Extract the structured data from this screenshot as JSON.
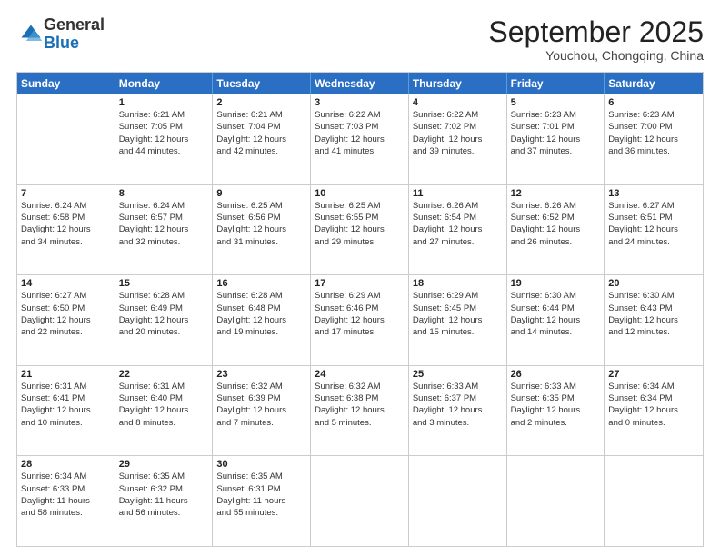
{
  "header": {
    "logo_general": "General",
    "logo_blue": "Blue",
    "month_title": "September 2025",
    "location": "Youchou, Chongqing, China"
  },
  "days_of_week": [
    "Sunday",
    "Monday",
    "Tuesday",
    "Wednesday",
    "Thursday",
    "Friday",
    "Saturday"
  ],
  "weeks": [
    [
      {
        "day": "",
        "lines": []
      },
      {
        "day": "1",
        "lines": [
          "Sunrise: 6:21 AM",
          "Sunset: 7:05 PM",
          "Daylight: 12 hours",
          "and 44 minutes."
        ]
      },
      {
        "day": "2",
        "lines": [
          "Sunrise: 6:21 AM",
          "Sunset: 7:04 PM",
          "Daylight: 12 hours",
          "and 42 minutes."
        ]
      },
      {
        "day": "3",
        "lines": [
          "Sunrise: 6:22 AM",
          "Sunset: 7:03 PM",
          "Daylight: 12 hours",
          "and 41 minutes."
        ]
      },
      {
        "day": "4",
        "lines": [
          "Sunrise: 6:22 AM",
          "Sunset: 7:02 PM",
          "Daylight: 12 hours",
          "and 39 minutes."
        ]
      },
      {
        "day": "5",
        "lines": [
          "Sunrise: 6:23 AM",
          "Sunset: 7:01 PM",
          "Daylight: 12 hours",
          "and 37 minutes."
        ]
      },
      {
        "day": "6",
        "lines": [
          "Sunrise: 6:23 AM",
          "Sunset: 7:00 PM",
          "Daylight: 12 hours",
          "and 36 minutes."
        ]
      }
    ],
    [
      {
        "day": "7",
        "lines": [
          "Sunrise: 6:24 AM",
          "Sunset: 6:58 PM",
          "Daylight: 12 hours",
          "and 34 minutes."
        ]
      },
      {
        "day": "8",
        "lines": [
          "Sunrise: 6:24 AM",
          "Sunset: 6:57 PM",
          "Daylight: 12 hours",
          "and 32 minutes."
        ]
      },
      {
        "day": "9",
        "lines": [
          "Sunrise: 6:25 AM",
          "Sunset: 6:56 PM",
          "Daylight: 12 hours",
          "and 31 minutes."
        ]
      },
      {
        "day": "10",
        "lines": [
          "Sunrise: 6:25 AM",
          "Sunset: 6:55 PM",
          "Daylight: 12 hours",
          "and 29 minutes."
        ]
      },
      {
        "day": "11",
        "lines": [
          "Sunrise: 6:26 AM",
          "Sunset: 6:54 PM",
          "Daylight: 12 hours",
          "and 27 minutes."
        ]
      },
      {
        "day": "12",
        "lines": [
          "Sunrise: 6:26 AM",
          "Sunset: 6:52 PM",
          "Daylight: 12 hours",
          "and 26 minutes."
        ]
      },
      {
        "day": "13",
        "lines": [
          "Sunrise: 6:27 AM",
          "Sunset: 6:51 PM",
          "Daylight: 12 hours",
          "and 24 minutes."
        ]
      }
    ],
    [
      {
        "day": "14",
        "lines": [
          "Sunrise: 6:27 AM",
          "Sunset: 6:50 PM",
          "Daylight: 12 hours",
          "and 22 minutes."
        ]
      },
      {
        "day": "15",
        "lines": [
          "Sunrise: 6:28 AM",
          "Sunset: 6:49 PM",
          "Daylight: 12 hours",
          "and 20 minutes."
        ]
      },
      {
        "day": "16",
        "lines": [
          "Sunrise: 6:28 AM",
          "Sunset: 6:48 PM",
          "Daylight: 12 hours",
          "and 19 minutes."
        ]
      },
      {
        "day": "17",
        "lines": [
          "Sunrise: 6:29 AM",
          "Sunset: 6:46 PM",
          "Daylight: 12 hours",
          "and 17 minutes."
        ]
      },
      {
        "day": "18",
        "lines": [
          "Sunrise: 6:29 AM",
          "Sunset: 6:45 PM",
          "Daylight: 12 hours",
          "and 15 minutes."
        ]
      },
      {
        "day": "19",
        "lines": [
          "Sunrise: 6:30 AM",
          "Sunset: 6:44 PM",
          "Daylight: 12 hours",
          "and 14 minutes."
        ]
      },
      {
        "day": "20",
        "lines": [
          "Sunrise: 6:30 AM",
          "Sunset: 6:43 PM",
          "Daylight: 12 hours",
          "and 12 minutes."
        ]
      }
    ],
    [
      {
        "day": "21",
        "lines": [
          "Sunrise: 6:31 AM",
          "Sunset: 6:41 PM",
          "Daylight: 12 hours",
          "and 10 minutes."
        ]
      },
      {
        "day": "22",
        "lines": [
          "Sunrise: 6:31 AM",
          "Sunset: 6:40 PM",
          "Daylight: 12 hours",
          "and 8 minutes."
        ]
      },
      {
        "day": "23",
        "lines": [
          "Sunrise: 6:32 AM",
          "Sunset: 6:39 PM",
          "Daylight: 12 hours",
          "and 7 minutes."
        ]
      },
      {
        "day": "24",
        "lines": [
          "Sunrise: 6:32 AM",
          "Sunset: 6:38 PM",
          "Daylight: 12 hours",
          "and 5 minutes."
        ]
      },
      {
        "day": "25",
        "lines": [
          "Sunrise: 6:33 AM",
          "Sunset: 6:37 PM",
          "Daylight: 12 hours",
          "and 3 minutes."
        ]
      },
      {
        "day": "26",
        "lines": [
          "Sunrise: 6:33 AM",
          "Sunset: 6:35 PM",
          "Daylight: 12 hours",
          "and 2 minutes."
        ]
      },
      {
        "day": "27",
        "lines": [
          "Sunrise: 6:34 AM",
          "Sunset: 6:34 PM",
          "Daylight: 12 hours",
          "and 0 minutes."
        ]
      }
    ],
    [
      {
        "day": "28",
        "lines": [
          "Sunrise: 6:34 AM",
          "Sunset: 6:33 PM",
          "Daylight: 11 hours",
          "and 58 minutes."
        ]
      },
      {
        "day": "29",
        "lines": [
          "Sunrise: 6:35 AM",
          "Sunset: 6:32 PM",
          "Daylight: 11 hours",
          "and 56 minutes."
        ]
      },
      {
        "day": "30",
        "lines": [
          "Sunrise: 6:35 AM",
          "Sunset: 6:31 PM",
          "Daylight: 11 hours",
          "and 55 minutes."
        ]
      },
      {
        "day": "",
        "lines": []
      },
      {
        "day": "",
        "lines": []
      },
      {
        "day": "",
        "lines": []
      },
      {
        "day": "",
        "lines": []
      }
    ]
  ]
}
